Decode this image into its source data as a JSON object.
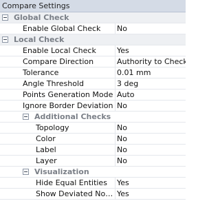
{
  "panel": {
    "title": "Compare Settings",
    "global_check": {
      "label": "Global Check",
      "enable_global_check": {
        "name": "Enable Global Check",
        "value": "No"
      }
    },
    "local_check": {
      "label": "Local Check",
      "enable_local_check": {
        "name": "Enable Local Check",
        "value": "Yes"
      },
      "compare_direction": {
        "name": "Compare Direction",
        "value": "Authority to Check"
      },
      "tolerance": {
        "name": "Tolerance",
        "value": "0.01 mm"
      },
      "angle_threshold": {
        "name": "Angle Threshold",
        "value": "3 deg"
      },
      "points_generation_mode": {
        "name": "Points Generation Mode",
        "value": "Auto"
      },
      "ignore_border_deviation": {
        "name": "Ignore Border Deviation",
        "value": "No"
      },
      "additional_checks": {
        "label": "Additional Checks",
        "topology": {
          "name": "Topology",
          "value": "No"
        },
        "color": {
          "name": "Color",
          "value": "No"
        },
        "label_prop": {
          "name": "Label",
          "value": "No"
        },
        "layer": {
          "name": "Layer",
          "value": "No"
        }
      },
      "visualization": {
        "label": "Visualization",
        "hide_equal_entities": {
          "name": "Hide Equal Entities",
          "value": "Yes"
        },
        "show_deviated_normals": {
          "name": "Show Deviated Nor...",
          "value": "Yes"
        }
      }
    }
  }
}
